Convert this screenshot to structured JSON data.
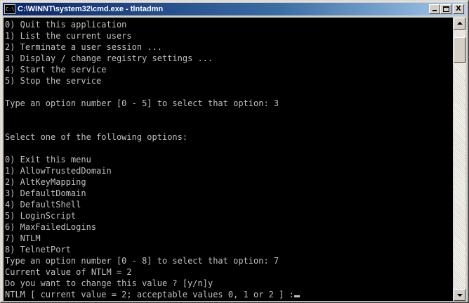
{
  "window": {
    "title": "C:\\WINNT\\system32\\cmd.exe - tlntadmn",
    "icon_label": "C:\\"
  },
  "title_buttons": {
    "minimize_icon": "minimize-icon",
    "maximize_icon": "maximize-icon",
    "close_label": "X"
  },
  "console": {
    "lines": [
      "0) Quit this application",
      "1) List the current users",
      "2) Terminate a user session ...",
      "3) Display / change registry settings ...",
      "4) Start the service",
      "5) Stop the service",
      "",
      "Type an option number [0 - 5] to select that option: 3",
      "",
      "",
      "Select one of the following options:",
      "",
      "0) Exit this menu",
      "1) AllowTrustedDomain",
      "2) AltKeyMapping",
      "3) DefaultDomain",
      "4) DefaultShell",
      "5) LoginScript",
      "6) MaxFailedLogins",
      "7) NTLM",
      "8) TelnetPort",
      "Type an option number [0 - 8] to select that option: 7",
      "Current value of NTLM = 2",
      "Do you want to change this value ? [y/n]y",
      "NTLM [ current value = 2; acceptable values 0, 1 or 2 ] :"
    ]
  },
  "colors": {
    "console_bg": "#000000",
    "console_fg": "#c0c0c0",
    "titlebar_start": "#0a246a",
    "titlebar_end": "#a6caf0"
  }
}
